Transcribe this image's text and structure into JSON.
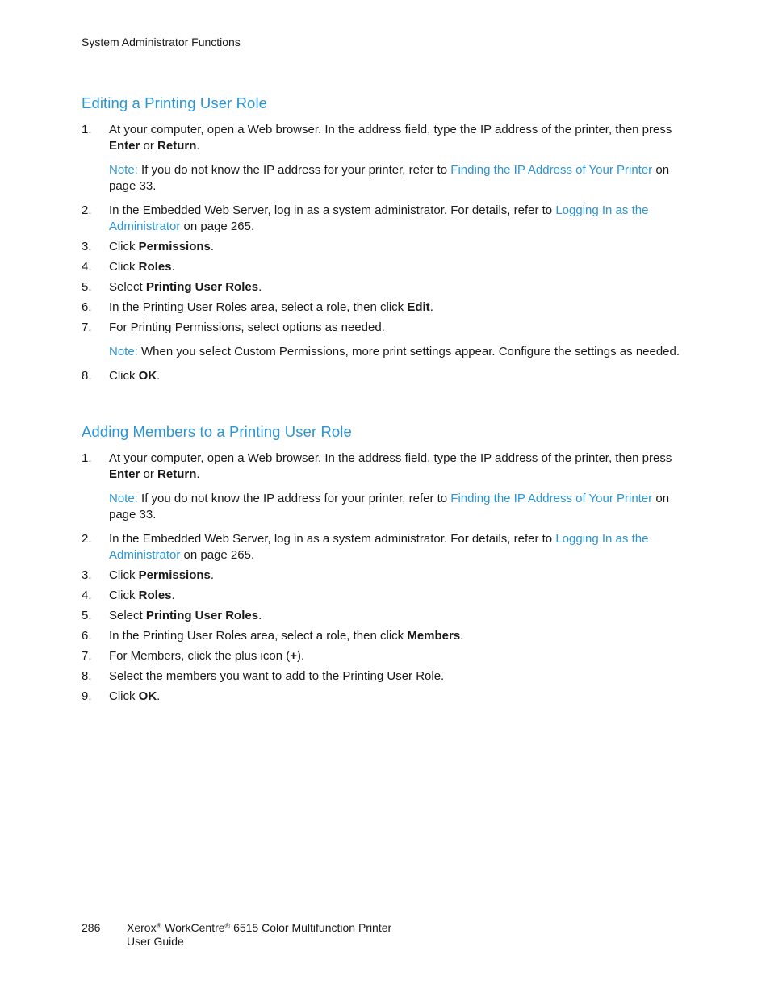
{
  "header": {
    "running_head": "System Administrator Functions"
  },
  "sections": [
    {
      "title": "Editing a Printing User Role",
      "steps": [
        {
          "num": "1.",
          "pre": "At your computer, open a Web browser. In the address field, type the IP address of the printer, then press ",
          "b1": "Enter",
          "mid": " or ",
          "b2": "Return",
          "post": ".",
          "note": {
            "label": "Note:",
            "text": " If you do not know the IP address for your printer, refer to ",
            "link": "Finding the IP Address of Your Printer",
            "after": " on page 33."
          }
        },
        {
          "num": "2.",
          "pre": "In the Embedded Web Server, log in as a system administrator. For details, refer to ",
          "link": "Logging In as the Administrator",
          "post": " on page 265."
        },
        {
          "num": "3.",
          "pre": "Click ",
          "b1": "Permissions",
          "post": "."
        },
        {
          "num": "4.",
          "pre": "Click ",
          "b1": "Roles",
          "post": "."
        },
        {
          "num": "5.",
          "pre": "Select ",
          "b1": "Printing User Roles",
          "post": "."
        },
        {
          "num": "6.",
          "pre": "In the Printing User Roles area, select a role, then click ",
          "b1": "Edit",
          "post": "."
        },
        {
          "num": "7.",
          "pre": "For Printing Permissions, select options as needed.",
          "note": {
            "label": "Note:",
            "text": " When you select Custom Permissions, more print settings appear. Configure the settings as needed."
          }
        },
        {
          "num": "8.",
          "pre": "Click ",
          "b1": "OK",
          "post": "."
        }
      ]
    },
    {
      "title": "Adding Members to a Printing User Role",
      "steps": [
        {
          "num": "1.",
          "pre": "At your computer, open a Web browser. In the address field, type the IP address of the printer, then press ",
          "b1": "Enter",
          "mid": " or ",
          "b2": "Return",
          "post": ".",
          "note": {
            "label": "Note:",
            "text": " If you do not know the IP address for your printer, refer to ",
            "link": "Finding the IP Address of Your Printer",
            "after": " on page 33."
          }
        },
        {
          "num": "2.",
          "pre": "In the Embedded Web Server, log in as a system administrator. For details, refer to ",
          "link": "Logging In as the Administrator",
          "post": " on page 265."
        },
        {
          "num": "3.",
          "pre": "Click ",
          "b1": "Permissions",
          "post": "."
        },
        {
          "num": "4.",
          "pre": "Click ",
          "b1": "Roles",
          "post": "."
        },
        {
          "num": "5.",
          "pre": "Select ",
          "b1": "Printing User Roles",
          "post": "."
        },
        {
          "num": "6.",
          "pre": "In the Printing User Roles area, select a role, then click ",
          "b1": "Members",
          "post": "."
        },
        {
          "num": "7.",
          "pre": "For Members, click the plus icon (",
          "b1": "+",
          "post": ")."
        },
        {
          "num": "8.",
          "pre": "Select the members you want to add to the Printing User Role."
        },
        {
          "num": "9.",
          "pre": "Click ",
          "b1": "OK",
          "post": "."
        }
      ]
    }
  ],
  "footer": {
    "page_number": "286",
    "brand": "Xerox",
    "reg": "®",
    "product": " WorkCentre",
    "product_rest": " 6515 Color Multifunction Printer",
    "guide": "User Guide"
  },
  "colors": {
    "accent": "#2a95d5",
    "text": "#1a1a1a"
  }
}
